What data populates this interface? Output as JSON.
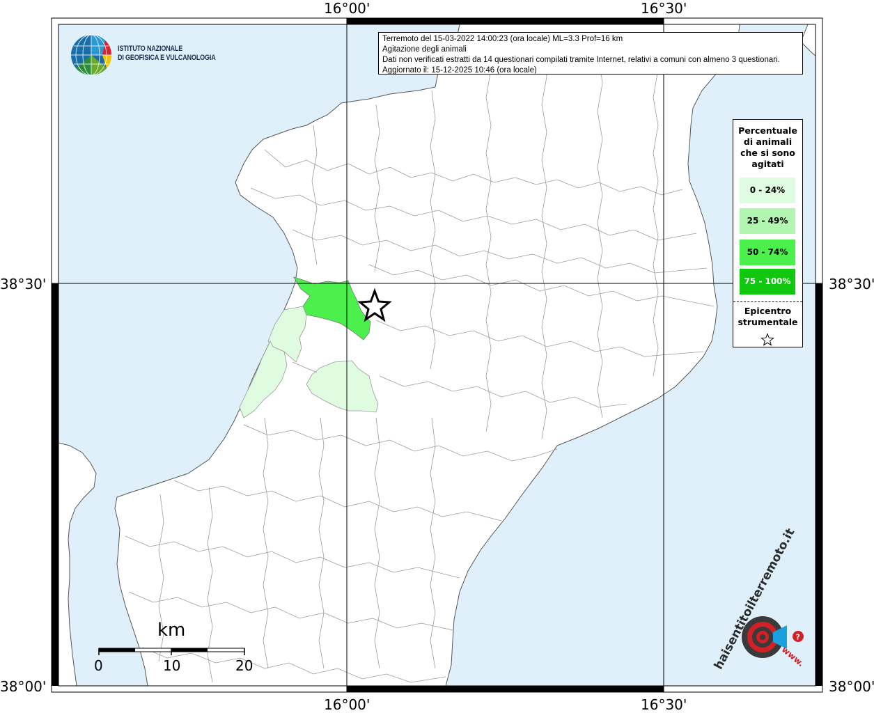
{
  "map": {
    "colors": {
      "sea": "#dff0fb",
      "land": "#ffffff",
      "border": "#8a8a8a",
      "coast": "#555555",
      "class_0_24": "#e0fce0",
      "class_25_49": "#b0f5b0",
      "class_50_74": "#4cf04c",
      "class_75_100": "#10c810"
    },
    "axes": {
      "top": [
        "16°00'",
        "16°30'"
      ],
      "bottom": [
        "16°00'",
        "16°30'"
      ],
      "left": [
        "38°30'",
        "38°00'"
      ],
      "right": [
        "38°30'",
        "38°00'"
      ]
    }
  },
  "info": {
    "line1": "Terremoto del 15-03-2022 14:00:23 (ora locale) ML=3.3 Prof=16 km",
    "line2": "Agitazione degli animali",
    "line3": "Dati non verificati estratti da 14 questionari compilati tramite Internet, relativi a comuni con almeno 3 questionari.",
    "line4": "Aggiornato il: 15-12-2025 10:46 (ora locale)"
  },
  "logo": {
    "line1": "ISTITUTO NAZIONALE",
    "line2": "DI GEOFISICA E VULCANOLOGIA"
  },
  "legend": {
    "title": [
      "Percentuale",
      "di animali",
      "che si sono",
      "agitati"
    ],
    "items": [
      {
        "label": "0 - 24%",
        "color": "#e0fce0",
        "text_color": "#000000"
      },
      {
        "label": "25 - 49%",
        "color": "#b0f5b0",
        "text_color": "#000000"
      },
      {
        "label": "50 - 74%",
        "color": "#4cf04c",
        "text_color": "#000000"
      },
      {
        "label": "75 - 100%",
        "color": "#10c810",
        "text_color": "#ffffff"
      }
    ],
    "epicenter": [
      "Epicentro",
      "strumentale"
    ]
  },
  "scale": {
    "unit": "km",
    "ticks": [
      "0",
      "10",
      "20"
    ]
  },
  "brand": {
    "text": "haisentitoilterremoto.it",
    "prefix": "www."
  }
}
